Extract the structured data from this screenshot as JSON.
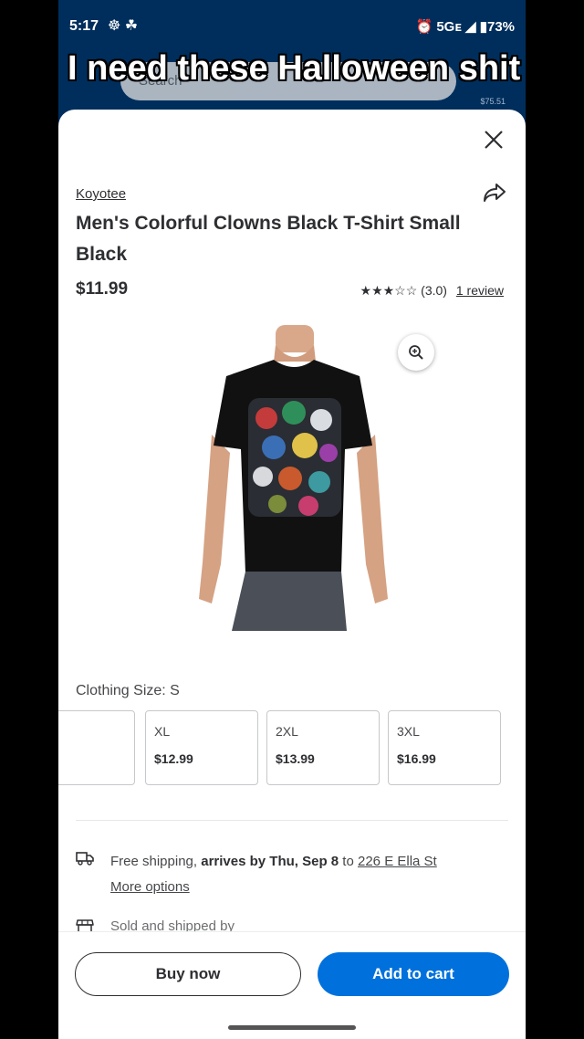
{
  "status_bar": {
    "time": "5:17",
    "notif_icons": "☸ ☘",
    "right": "⏰ 5Gᴇ ◢ ▮73%"
  },
  "background": {
    "search_placeholder": "Search",
    "cart_amount": "$75.51"
  },
  "caption": "I need these Halloween shit",
  "product": {
    "brand": "Koyotee",
    "title": "Men's Colorful Clowns Black T-Shirt Small Black",
    "price": "$11.99",
    "stars": "★★★☆☆",
    "rating": "(3.0)",
    "reviews": "1 review",
    "rating_value": 3.0
  },
  "clothing_size_label": "Clothing Size: S",
  "sizes": [
    {
      "name": "XL",
      "price": "$12.99"
    },
    {
      "name": "2XL",
      "price": "$13.99"
    },
    {
      "name": "3XL",
      "price": "$16.99"
    }
  ],
  "shipping": {
    "prefix": "Free shipping, ",
    "arrives": "arrives by Thu, Sep 8",
    "to": " to ",
    "address": "226 E Ella St",
    "more": "More options"
  },
  "sold_by": "Sold and shipped by",
  "buttons": {
    "buy_now": "Buy now",
    "add_to_cart": "Add to cart"
  },
  "colors": {
    "brand_blue": "#0071dc",
    "header_navy": "#002e5c",
    "text_dark": "#2e2f32"
  },
  "icons": [
    "close-icon",
    "share-icon",
    "zoom-in-icon",
    "truck-icon",
    "store-icon"
  ]
}
